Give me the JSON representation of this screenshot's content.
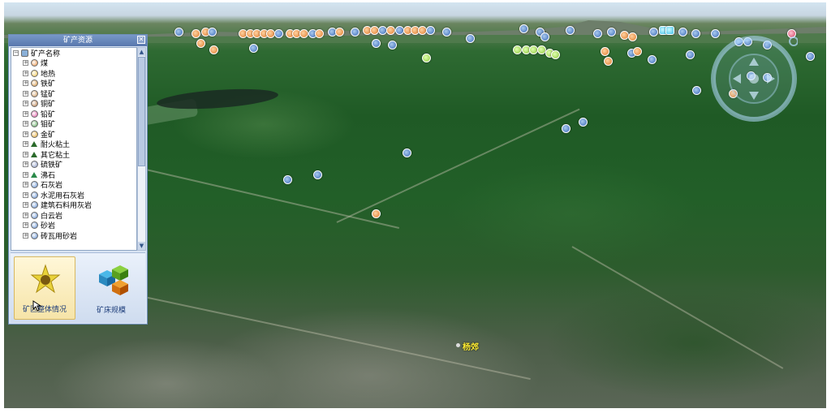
{
  "panel": {
    "title": "矿产资源",
    "close_glyph": "✕",
    "tree_root": "矿产名称",
    "tree_items": [
      {
        "label": "煤",
        "icon": "coal-icon",
        "color": "#e88a3a"
      },
      {
        "label": "地热",
        "icon": "geothermal-icon",
        "color": "#f0c040"
      },
      {
        "label": "铁矿",
        "icon": "iron-ore-icon",
        "color": "#d08a30"
      },
      {
        "label": "锰矿",
        "icon": "manganese-icon",
        "color": "#c89050"
      },
      {
        "label": "铜矿",
        "icon": "copper-icon",
        "color": "#b0703a"
      },
      {
        "label": "铅矿",
        "icon": "lead-icon",
        "color": "#e050a0"
      },
      {
        "label": "钼矿",
        "icon": "molybdenum-icon",
        "color": "#50a050"
      },
      {
        "label": "金矿",
        "icon": "gold-icon",
        "color": "#e0a020"
      },
      {
        "label": "耐火粘土",
        "icon": "triangle-icon",
        "color": "#2a6a2a"
      },
      {
        "label": "其它粘土",
        "icon": "triangle-icon",
        "color": "#2a6a2a"
      },
      {
        "label": "硫铁矿",
        "icon": "pyrite-icon",
        "color": "#8090c0"
      },
      {
        "label": "沸石",
        "icon": "triangle-icon",
        "color": "#2a8a4a"
      },
      {
        "label": "石灰岩",
        "icon": "limestone-icon",
        "color": "#5a8ad0"
      },
      {
        "label": "水泥用石灰岩",
        "icon": "limestone-icon",
        "color": "#5a8ad0"
      },
      {
        "label": "建筑石料用灰岩",
        "icon": "limestone-icon",
        "color": "#5a8ad0"
      },
      {
        "label": "白云岩",
        "icon": "dolomite-icon",
        "color": "#5a8ad0"
      },
      {
        "label": "砂岩",
        "icon": "sandstone-icon",
        "color": "#5a8ad0"
      },
      {
        "label": "砖瓦用砂岩",
        "icon": "sandstone-icon",
        "color": "#5a8ad0"
      }
    ],
    "tools": [
      {
        "label": "矿区整体情况",
        "icon": "mining-overview-icon"
      },
      {
        "label": "矿床规模",
        "icon": "deposit-scale-icon"
      }
    ]
  },
  "map": {
    "place_label": "杨郊"
  }
}
